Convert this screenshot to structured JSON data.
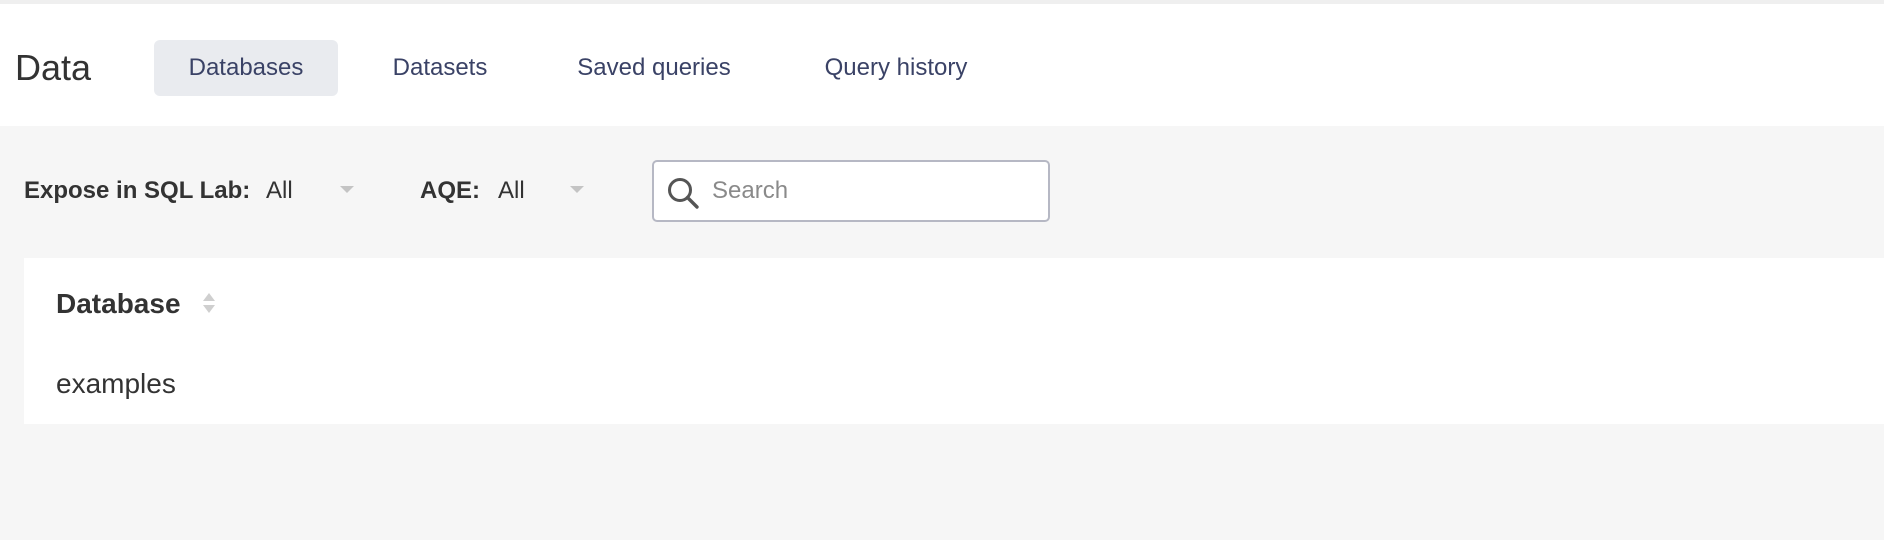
{
  "header": {
    "title": "Data",
    "tabs": [
      {
        "label": "Databases",
        "active": true
      },
      {
        "label": "Datasets",
        "active": false
      },
      {
        "label": "Saved queries",
        "active": false
      },
      {
        "label": "Query history",
        "active": false
      }
    ]
  },
  "filters": {
    "expose_label": "Expose in SQL Lab:",
    "expose_value": "All",
    "aqe_label": "AQE:",
    "aqe_value": "All",
    "search_placeholder": "Search",
    "search_value": ""
  },
  "table": {
    "columns": [
      {
        "label": "Database",
        "sortable": true
      }
    ],
    "rows": [
      {
        "database": "examples"
      }
    ]
  },
  "icons": {
    "search": "search-icon",
    "sort": "sort-icon",
    "dropdown": "chevron-down-icon"
  },
  "colors": {
    "background": "#f6f6f6",
    "active_tab": "#e9ebef",
    "tab_text": "#3a4266",
    "text": "#333333",
    "search_border": "#b6b8c4"
  }
}
